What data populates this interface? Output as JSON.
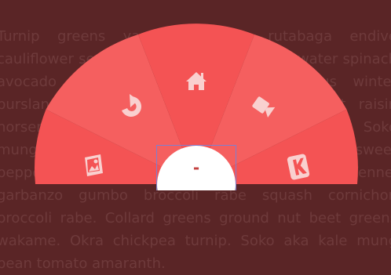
{
  "background_text": "Turnip greens yarrow ricebean rutabaga endive cauliflower sea lettuce kohlrabi amaranth water spinach avocado daikon napa cabbage asparagus winter purslane kale. Celery potato scallion desert raisin horseradish wattle seed sweet potato peanut. Soko mung bean burdock lentil garlic. Water spinach sweet pepper radicchio kale parsnip leek bean shoot fennel garbanzo gumbo broccoli rabe squash cornichon broccoli rabe. Collard greens ground nut beet greens wakame. Okra chickpea turnip. Soko aka kale mung bean tomato amaranth.",
  "colors": {
    "background": "#5a2526",
    "sector_fill": "#f45354",
    "sector_alt_fill": "#f55f5f",
    "center_fill": "#ffffff",
    "icon_fill": "#f9d0cf"
  },
  "menu": {
    "items": [
      {
        "name": "image-icon"
      },
      {
        "name": "refresh-icon"
      },
      {
        "name": "home-icon"
      },
      {
        "name": "video-camera-icon"
      },
      {
        "name": "kickstarter-icon"
      }
    ],
    "center_label": "-"
  }
}
